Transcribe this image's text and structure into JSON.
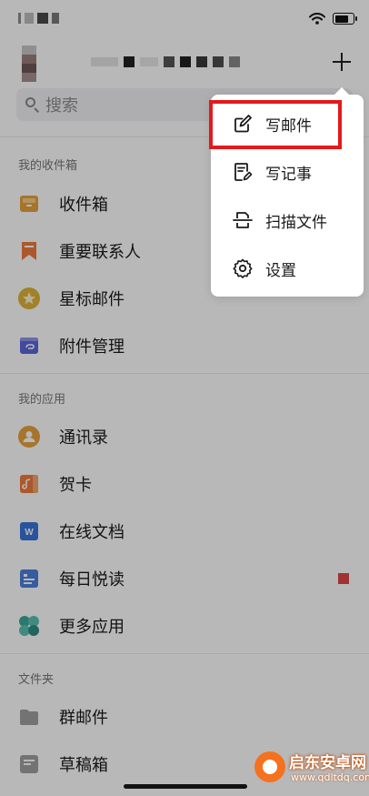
{
  "app": {
    "search_placeholder": "搜索"
  },
  "sections": {
    "inbox_title": "我的收件箱",
    "apps_title": "我的应用",
    "folders_title": "文件夹"
  },
  "inbox_items": [
    {
      "label": "收件箱",
      "icon": "inbox-tray-icon",
      "color": "#e6a23c"
    },
    {
      "label": "重要联系人",
      "icon": "bookmark-icon",
      "color": "#ef7a3c"
    },
    {
      "label": "星标邮件",
      "icon": "star-icon",
      "color": "#e0b33a"
    },
    {
      "label": "附件管理",
      "icon": "attachment-icon",
      "color": "#5a67d8"
    }
  ],
  "app_items": [
    {
      "label": "通讯录",
      "icon": "contacts-icon",
      "color": "#e6a23c"
    },
    {
      "label": "贺卡",
      "icon": "greeting-card-icon",
      "color": "#ef7a3c"
    },
    {
      "label": "在线文档",
      "icon": "online-doc-icon",
      "color": "#3a73d8",
      "glyph": "W"
    },
    {
      "label": "每日悦读",
      "icon": "daily-reading-icon",
      "color": "#4a7fe0"
    },
    {
      "label": "更多应用",
      "icon": "more-apps-icon",
      "color": "#3aa89a"
    }
  ],
  "folder_items": [
    {
      "label": "群邮件",
      "icon": "folder-icon",
      "color": "#a0a0a0"
    },
    {
      "label": "草稿箱",
      "icon": "drafts-icon",
      "color": "#a0a0a0"
    }
  ],
  "menu": {
    "items": [
      {
        "label": "写邮件",
        "icon": "compose-icon"
      },
      {
        "label": "写记事",
        "icon": "note-icon"
      },
      {
        "label": "扫描文件",
        "icon": "scan-icon"
      },
      {
        "label": "设置",
        "icon": "gear-icon"
      }
    ]
  },
  "colors": {
    "highlight": "#e3191c",
    "badge": "#e04646"
  },
  "status": {
    "battery_level": 0.75
  },
  "watermark": {
    "title": "启东安卓网",
    "url": "www.qdltdq.com"
  }
}
